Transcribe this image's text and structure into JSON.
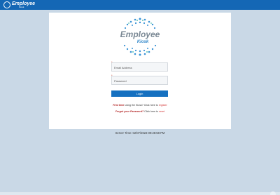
{
  "header": {
    "brand_title": "Employee",
    "brand_subtitle": "Kiosk"
  },
  "logo": {
    "title": "Employee",
    "subtitle": "Kiosk"
  },
  "login": {
    "email_placeholder": "Email Address",
    "password_placeholder": "Password",
    "required_marker": "*",
    "login_label": "Login"
  },
  "help": {
    "first_time_bold": "First time",
    "first_time_text": " using the Kiosk? Click here to ",
    "first_time_link": "register",
    "forgot_bold": "Forgot your Password?",
    "forgot_text": " Click here to ",
    "forgot_link": "reset"
  },
  "server_time": "Server Time: 02/07/2023 09:28:58 PM",
  "colors": {
    "header_bg": "#1467b5",
    "accent": "#1570c0",
    "link_red": "#d23030",
    "page_bg": "#c9d8e6"
  }
}
